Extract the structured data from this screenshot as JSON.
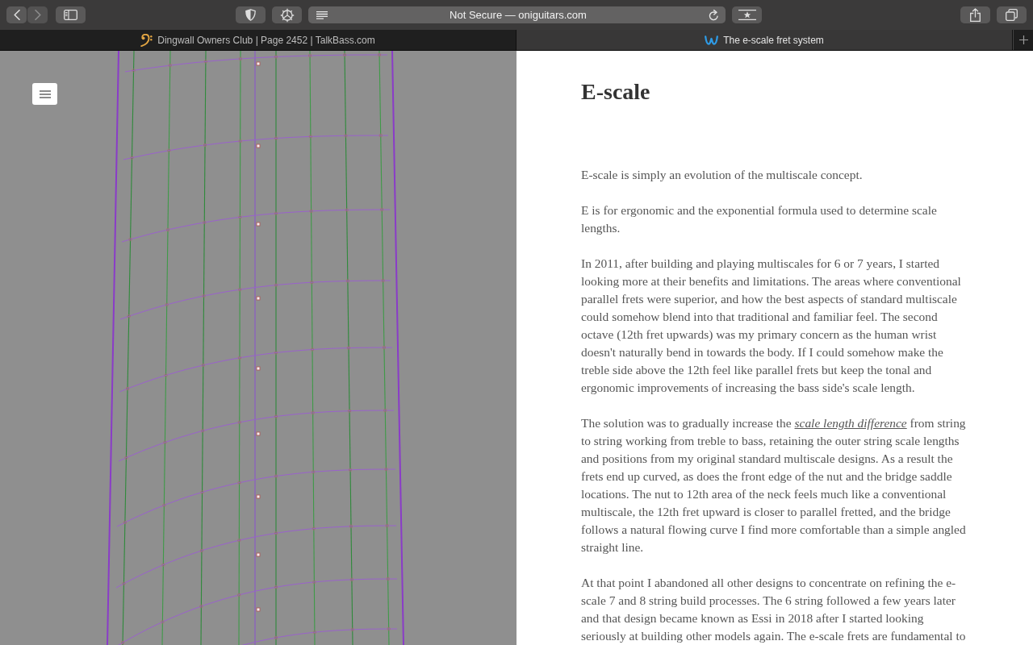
{
  "toolbar": {
    "back_button": {
      "disabled": false
    },
    "forward_button": {
      "disabled": true
    },
    "address_bar": {
      "text": "Not Secure — oniguitars.com"
    }
  },
  "tabs": [
    {
      "title": "Dingwall Owners Club | Page 2452 | TalkBass.com",
      "selected": false
    },
    {
      "title": "The e-scale fret system",
      "selected": true
    }
  ],
  "article": {
    "title": "E-scale",
    "paragraphs": [
      {
        "text": "E-scale is simply an evolution of the multiscale concept."
      },
      {
        "text": "E is for ergonomic and the exponential formula used to determine scale lengths."
      },
      {
        "text": "In 2011, after building and playing multiscales for 6 or 7 years, I started looking more at their benefits and limitations. The areas where conventional parallel frets were superior, and how the best aspects of standard multiscale could somehow blend into that traditional and familiar feel. The second octave (12th fret upwards) was my primary concern as the human wrist doesn't naturally bend in towards the body. If I could somehow make the treble side above the 12th feel like parallel frets but keep the tonal and ergonomic improvements of increasing the bass side's scale length."
      },
      {
        "text": "The solution was to gradually increase the ",
        "link": "scale length difference",
        "text_after": " from string to string working from treble to bass, retaining the outer string scale lengths and positions from my original standard multiscale designs. As a result the frets end up curved, as does the front edge of the nut and the bridge saddle locations. The nut to 12th area of the neck feels much like a conventional multiscale, the 12th fret upward is closer to parallel fretted, and the bridge follows a natural flowing curve I find more comfortable than a simple angled straight line."
      },
      {
        "text": "At that point I abandoned all other designs to concentrate on refining the e-scale 7 and 8 string build processes. The 6 string followed a few years later and that design became known as Essi in 2018 after I started looking seriously at building other models again. The e-scale frets are fundamental to"
      }
    ]
  }
}
